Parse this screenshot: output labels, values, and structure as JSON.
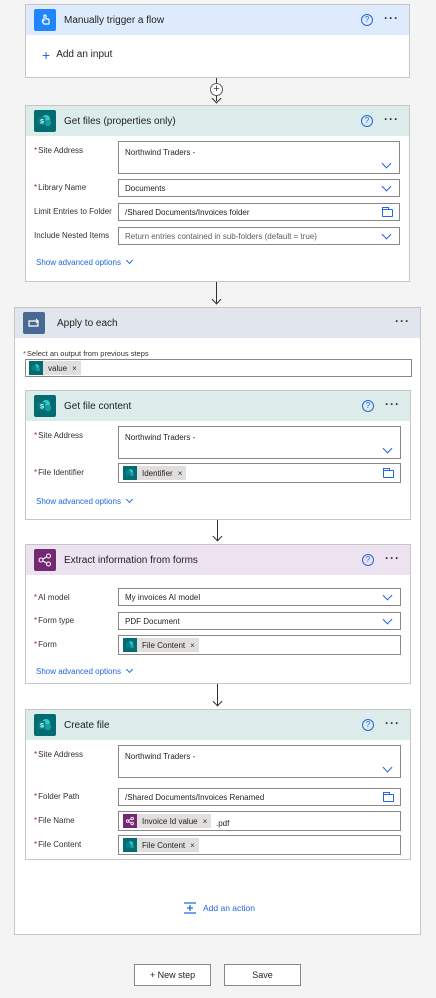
{
  "trigger": {
    "title": "Manually trigger a flow",
    "add_input": "Add an input"
  },
  "get_files": {
    "title": "Get files (properties only)",
    "site_address_label": "Site Address",
    "site_address_value": "Northwind Traders -",
    "library_label": "Library Name",
    "library_value": "Documents",
    "limit_label": "Limit Entries to Folder",
    "limit_value": "/Shared Documents/Invoices folder",
    "nested_label": "Include Nested Items",
    "nested_value": "Return entries contained in sub-folders (default = true)",
    "advanced": "Show advanced options"
  },
  "apply_each": {
    "title": "Apply to each",
    "select_label": "Select an output from previous steps",
    "token": "value"
  },
  "get_content": {
    "title": "Get file content",
    "site_address_label": "Site Address",
    "site_address_value": "Northwind Traders -",
    "file_id_label": "File Identifier",
    "file_id_token": "Identifier",
    "advanced": "Show advanced options"
  },
  "extract": {
    "title": "Extract information from forms",
    "ai_model_label": "AI model",
    "ai_model_value": "My invoices AI model",
    "form_type_label": "Form type",
    "form_type_value": "PDF Document",
    "form_label": "Form",
    "form_token": "File Content",
    "advanced": "Show advanced options"
  },
  "create_file": {
    "title": "Create file",
    "site_address_label": "Site Address",
    "site_address_value": "Northwind Traders -",
    "folder_label": "Folder Path",
    "folder_value": "/Shared Documents/Invoices Renamed",
    "name_label": "File Name",
    "name_token": "Invoice Id value",
    "name_suffix": ".pdf",
    "content_label": "File Content",
    "content_token": "File Content"
  },
  "add_action": "Add an action",
  "footer": {
    "new_step": "+ New step",
    "save": "Save"
  },
  "common": {
    "help": "?",
    "more": "···",
    "remove": "×",
    "required": "*"
  },
  "colors": {
    "trigger_header": "#ddebfd",
    "sharepoint_header": "#dbeceb",
    "apply_header": "#e1e5ee",
    "ai_header": "#ece2f0",
    "accent": "#2266e3",
    "sharepoint": "#036c70",
    "ai_builder": "#742774"
  }
}
